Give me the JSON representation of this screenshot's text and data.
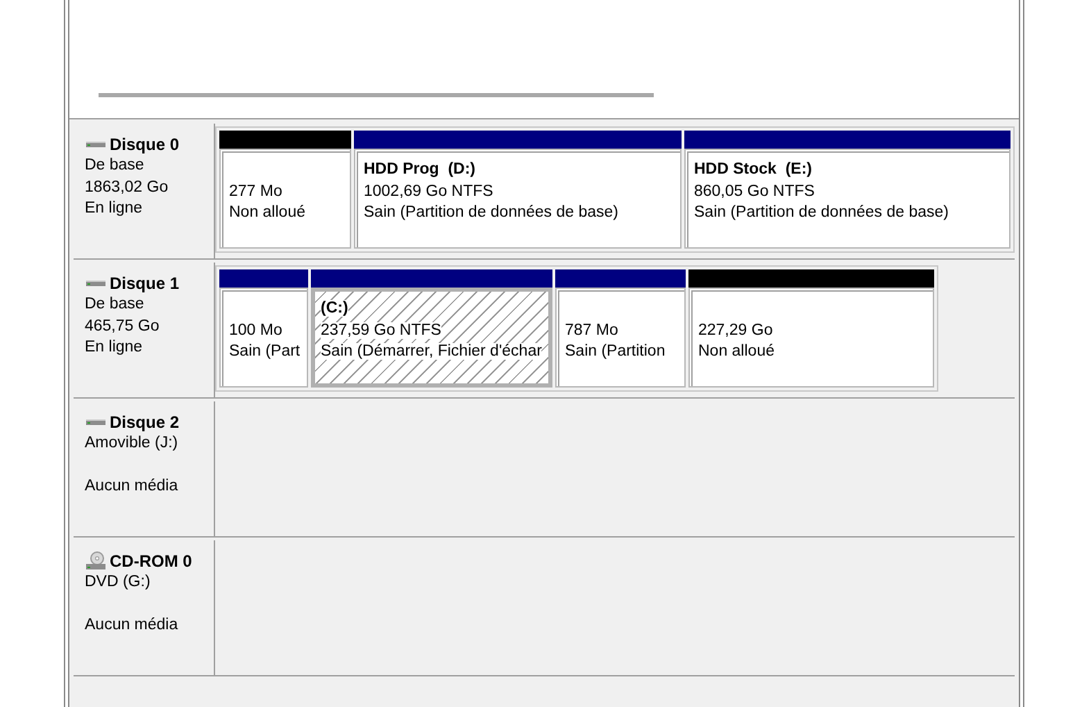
{
  "disks": [
    {
      "kind": "disk",
      "name": "Disque 0",
      "type": "De base",
      "capacity": "1863,02 Go",
      "status": "En ligne",
      "partitions": [
        {
          "size": "277 Mo",
          "state": "Non alloué",
          "color": "#000000",
          "selected": false
        },
        {
          "name": "HDD Prog  (D:)",
          "size": "1002,69 Go NTFS",
          "state": "Sain (Partition de données de base)",
          "color": "#000080",
          "selected": false
        },
        {
          "name": "HDD Stock  (E:)",
          "size": "860,05 Go NTFS",
          "state": "Sain (Partition de données de base)",
          "color": "#000080",
          "selected": false
        }
      ]
    },
    {
      "kind": "disk",
      "name": "Disque 1",
      "type": "De base",
      "capacity": "465,75 Go",
      "status": "En ligne",
      "partitions": [
        {
          "size": "100 Mo",
          "state": "Sain (Part",
          "color": "#000080",
          "selected": false
        },
        {
          "name": "(C:)",
          "size": "237,59 Go NTFS",
          "state": "Sain (Démarrer, Fichier d'échar",
          "color": "#000080",
          "selected": true
        },
        {
          "size": "787 Mo",
          "state": "Sain (Partition",
          "color": "#000080",
          "selected": false
        },
        {
          "size": "227,29 Go",
          "state": "Non alloué",
          "color": "#000000",
          "selected": false
        }
      ]
    },
    {
      "kind": "disk",
      "name": "Disque 2",
      "type": "Amovible (J:)",
      "status": "Aucun média"
    },
    {
      "kind": "cdrom",
      "name": "CD-ROM 0",
      "type": "DVD (G:)",
      "status": "Aucun média"
    }
  ]
}
